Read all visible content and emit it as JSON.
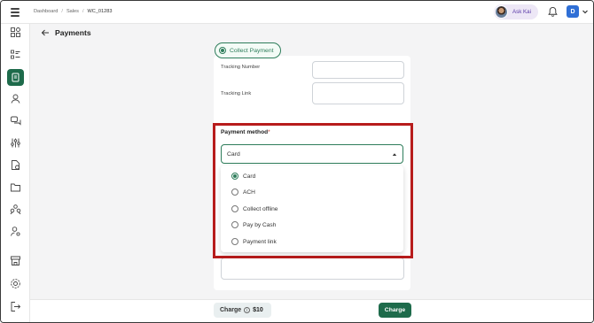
{
  "topbar": {
    "breadcrumb": [
      "Dashboard",
      "Sales",
      "WC_01283"
    ],
    "ask_kai_label": "Ask Kai",
    "user_initial": "D"
  },
  "page": {
    "title": "Payments"
  },
  "form": {
    "collect_payment_label": "Collect Payment",
    "tracking_number_label": "Tracking Number",
    "tracking_link_label": "Tracking Link",
    "payment_method_label": "Payment method",
    "payment_method_required": "*",
    "payment_method_value": "Card",
    "payment_method_options": [
      "Card",
      "ACH",
      "Collect offline",
      "Pay by Cash",
      "Payment link"
    ],
    "selected_option_index": 0
  },
  "footer": {
    "charge_label": "Charge",
    "charge_amount": "$10",
    "info_icon": "i",
    "charge_button_label": "Charge"
  },
  "colors": {
    "brand_green": "#1e6b4b",
    "highlight_red": "#b71c1c",
    "user_blue": "#2f6fd6"
  },
  "icons": {
    "sidebar": [
      "dashboard-icon",
      "list-icon",
      "document-icon",
      "user-icon",
      "chat-icon",
      "sliders-icon",
      "file-dollar-icon",
      "folder-icon",
      "team-icon",
      "user-settings-icon",
      "store-icon",
      "gear-icon",
      "logout-icon"
    ]
  }
}
